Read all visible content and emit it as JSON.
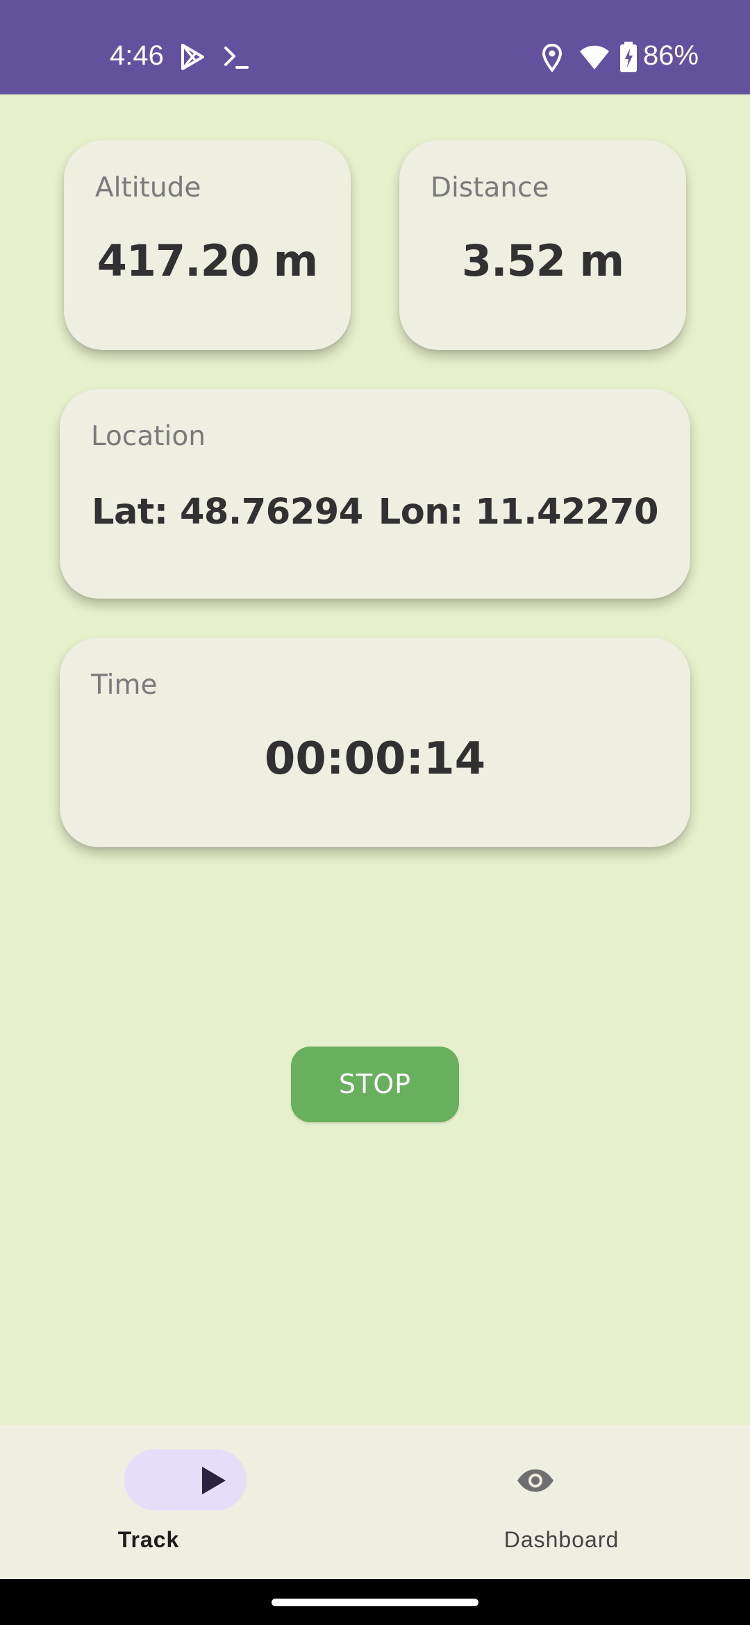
{
  "status_bar": {
    "time": "4:46",
    "battery_percent": "86%",
    "icons": [
      "play-store-icon",
      "terminal-icon",
      "location-icon",
      "wifi-icon",
      "battery-charging-icon"
    ],
    "background_color": "#62529e"
  },
  "cards": {
    "altitude": {
      "label": "Altitude",
      "value": "417.20 m"
    },
    "distance": {
      "label": "Distance",
      "value": "3.52 m"
    },
    "location": {
      "label": "Location",
      "lat": "Lat: 48.76294",
      "lon": "Lon: 11.42270"
    },
    "time": {
      "label": "Time",
      "value": "00:00:14"
    }
  },
  "actions": {
    "stop_label": "STOP",
    "stop_color": "#68af5e"
  },
  "bottom_nav": {
    "items": [
      {
        "label": "Track",
        "icon": "play-icon",
        "selected": true
      },
      {
        "label": "Dashboard",
        "icon": "eye-icon",
        "selected": false
      }
    ],
    "selected_pill_color": "#e6def8"
  },
  "colors": {
    "background": "#e7f0cc",
    "card": "#eeeee1"
  }
}
